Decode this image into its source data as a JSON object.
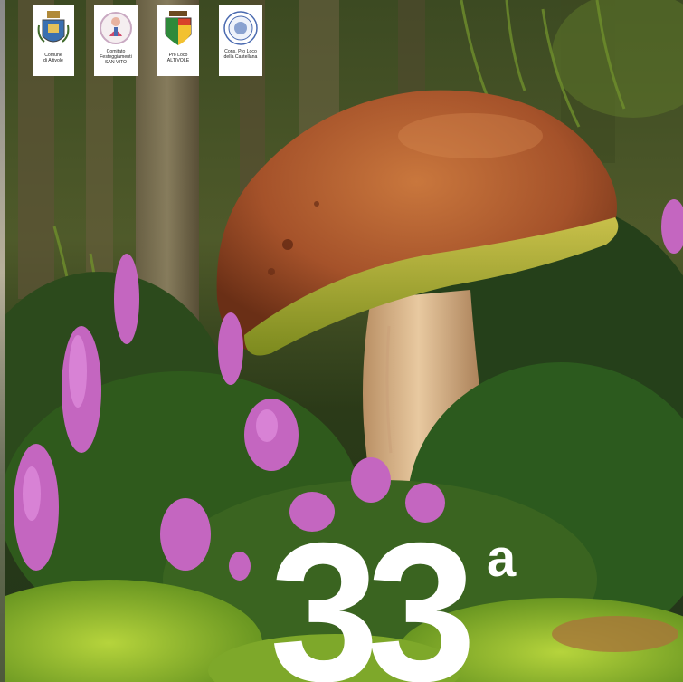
{
  "logos": [
    {
      "name": "comune-altivole",
      "caption": [
        "Comune",
        "di Altivole"
      ]
    },
    {
      "name": "comitato-san-vito",
      "caption": [
        "Comitato",
        "Festeggiamenti",
        "SAN VITO"
      ]
    },
    {
      "name": "pro-loco-altivole",
      "caption": [
        "Pro Loco",
        "ALTIVOLE"
      ]
    },
    {
      "name": "cons-pro-loco-castellana",
      "caption": [
        "Cons. Pro Loco",
        "della Castellana"
      ]
    }
  ],
  "edition": {
    "number": "33",
    "suffix": "a"
  },
  "colors": {
    "forest_dark": "#24301a",
    "mushroom_cap": "#a5522a",
    "mushroom_rim": "#b7c23a",
    "heather": "#c466c0",
    "text_white": "#ffffff"
  }
}
